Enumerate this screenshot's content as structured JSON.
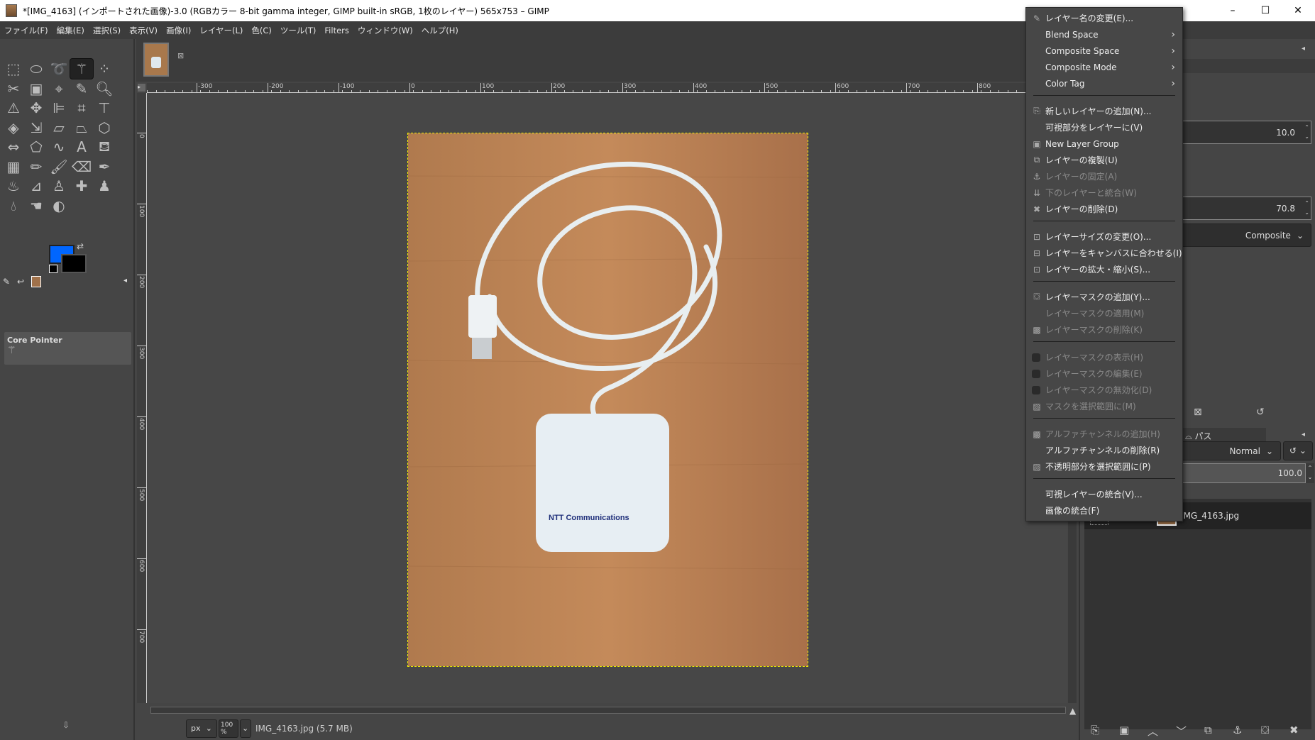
{
  "window": {
    "title": "*[IMG_4163] (インポートされた画像)-3.0 (RGBカラー 8-bit gamma integer, GIMP built-in sRGB, 1枚のレイヤー) 565x753 – GIMP",
    "minimize": "–",
    "maximize": "☐",
    "close": "✕"
  },
  "menubar": [
    "ファイル(F)",
    "編集(E)",
    "選択(S)",
    "表示(V)",
    "画像(I)",
    "レイヤー(L)",
    "色(C)",
    "ツール(T)",
    "Filters",
    "ウィンドウ(W)",
    "ヘルプ(H)"
  ],
  "toolbox": {
    "tools": [
      {
        "name": "rect-select",
        "glyph": "⬚"
      },
      {
        "name": "ellipse-select",
        "glyph": "⬭"
      },
      {
        "name": "free-select",
        "glyph": "➰"
      },
      {
        "name": "fuzzy-select",
        "glyph": "⚚",
        "active": true
      },
      {
        "name": "foreground-select",
        "glyph": "⁘"
      },
      {
        "name": "scissors-select",
        "glyph": "✂"
      },
      {
        "name": "paths-select",
        "glyph": "▣"
      },
      {
        "name": "paths",
        "glyph": "⌖"
      },
      {
        "name": "color-picker",
        "glyph": "✎"
      },
      {
        "name": "zoom",
        "glyph": "🔍︎"
      },
      {
        "name": "measure",
        "glyph": "⚠"
      },
      {
        "name": "move",
        "glyph": "✥"
      },
      {
        "name": "align",
        "glyph": "⊫"
      },
      {
        "name": "crop",
        "glyph": "⌗"
      },
      {
        "name": "unified-transform",
        "glyph": "⊤"
      },
      {
        "name": "rotate",
        "glyph": "◈"
      },
      {
        "name": "scale",
        "glyph": "⇲"
      },
      {
        "name": "shear",
        "glyph": "▱"
      },
      {
        "name": "perspective",
        "glyph": "⏢"
      },
      {
        "name": "3d-transform",
        "glyph": "⬡"
      },
      {
        "name": "flip",
        "glyph": "⇔"
      },
      {
        "name": "cage",
        "glyph": "⬠"
      },
      {
        "name": "warp",
        "glyph": "∿"
      },
      {
        "name": "text",
        "glyph": "A"
      },
      {
        "name": "bucket-fill",
        "glyph": "⛾"
      },
      {
        "name": "gradient",
        "glyph": "▦"
      },
      {
        "name": "pencil",
        "glyph": "✏"
      },
      {
        "name": "paintbrush",
        "glyph": "🖌︎"
      },
      {
        "name": "eraser",
        "glyph": "⌫"
      },
      {
        "name": "airbrush",
        "glyph": "✒"
      },
      {
        "name": "ink",
        "glyph": "♨"
      },
      {
        "name": "mypaint-brush",
        "glyph": "⊿"
      },
      {
        "name": "clone",
        "glyph": "♙"
      },
      {
        "name": "heal",
        "glyph": "✚"
      },
      {
        "name": "perspective-clone",
        "glyph": "♟"
      },
      {
        "name": "blur",
        "glyph": "💧︎"
      },
      {
        "name": "smudge",
        "glyph": "☚"
      },
      {
        "name": "dodge-burn",
        "glyph": "◐"
      }
    ],
    "fg_color": "#0066ff",
    "bg_color": "#000000",
    "device_status": {
      "title": "Core Pointer"
    }
  },
  "image_tab": {
    "name": "IMG_4163"
  },
  "rulers": {
    "h": [
      "-300",
      "-200",
      "-100",
      "0",
      "100",
      "200",
      "300",
      "400",
      "500",
      "600",
      "700",
      "800"
    ],
    "v": [
      "0",
      "100",
      "200",
      "300",
      "400",
      "500",
      "600",
      "700"
    ]
  },
  "status": {
    "unit": "px",
    "zoom": "100 %",
    "file": "IMG_4163.jpg (5.7 MB)"
  },
  "right_panel": {
    "size_value": "10.0",
    "value2": "70.8",
    "composite": "Composite",
    "paths_tab": "パス",
    "mode": "Normal",
    "opacity": "100.0",
    "layer_name": "IMG_4163.jpg",
    "bottom_buttons": [
      "new-layer",
      "new-layer-group",
      "raise-layer",
      "lower-layer",
      "duplicate-layer",
      "anchor-layer",
      "add-mask",
      "delete-layer"
    ]
  },
  "context_menu": {
    "items": [
      {
        "label": "レイヤー名の変更(E)...",
        "icon": "edit-icon"
      },
      {
        "label": "Blend Space",
        "submenu": true
      },
      {
        "label": "Composite Space",
        "submenu": true
      },
      {
        "label": "Composite Mode",
        "submenu": true
      },
      {
        "label": "Color Tag",
        "submenu": true
      },
      {
        "sep": true
      },
      {
        "label": "新しいレイヤーの追加(N)...",
        "icon": "new-layer-icon"
      },
      {
        "label": "可視部分をレイヤーに(V)"
      },
      {
        "label": "New Layer Group",
        "icon": "folder-plus-icon"
      },
      {
        "label": "レイヤーの複製(U)",
        "icon": "duplicate-icon"
      },
      {
        "label": "レイヤーの固定(A)",
        "icon": "anchor-icon",
        "disabled": true
      },
      {
        "label": "下のレイヤーと統合(W)",
        "icon": "merge-down-icon",
        "disabled": true
      },
      {
        "label": "レイヤーの削除(D)",
        "icon": "delete-icon"
      },
      {
        "sep": true
      },
      {
        "label": "レイヤーサイズの変更(O)...",
        "icon": "layer-size-icon"
      },
      {
        "label": "レイヤーをキャンバスに合わせる(I)",
        "icon": "layer-to-canvas-icon"
      },
      {
        "label": "レイヤーの拡大・縮小(S)...",
        "icon": "scale-layer-icon"
      },
      {
        "sep": true
      },
      {
        "label": "レイヤーマスクの追加(Y)...",
        "icon": "add-mask-icon"
      },
      {
        "label": "レイヤーマスクの適用(M)",
        "disabled": true
      },
      {
        "label": "レイヤーマスクの削除(K)",
        "icon": "delete-mask-icon",
        "disabled": true
      },
      {
        "sep": true
      },
      {
        "label": "レイヤーマスクの表示(H)",
        "check": true,
        "disabled": true
      },
      {
        "label": "レイヤーマスクの編集(E)",
        "check": true,
        "disabled": true
      },
      {
        "label": "レイヤーマスクの無効化(D)",
        "check": true,
        "disabled": true
      },
      {
        "label": "マスクを選択範囲に(M)",
        "icon": "mask-to-selection-icon",
        "disabled": true
      },
      {
        "sep": true
      },
      {
        "label": "アルファチャンネルの追加(H)",
        "icon": "add-alpha-icon",
        "disabled": true
      },
      {
        "label": "アルファチャンネルの削除(R)"
      },
      {
        "label": "不透明部分を選択範囲に(P)",
        "icon": "alpha-to-selection-icon"
      },
      {
        "sep": true
      },
      {
        "label": "可視レイヤーの統合(V)..."
      },
      {
        "label": "画像の統合(F)"
      }
    ]
  }
}
